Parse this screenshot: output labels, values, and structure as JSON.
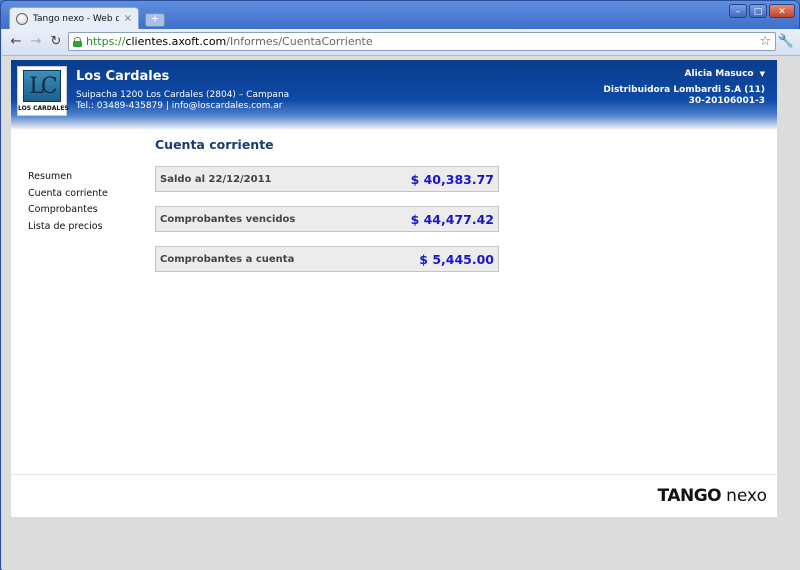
{
  "browser": {
    "tab_title": "Tango nexo - Web de clientes",
    "tab_close": "×",
    "new_tab": "+",
    "url_scheme": "https://",
    "url_host": "clientes.axoft.com",
    "url_path": "/Informes/CuentaCorriente",
    "icons": {
      "back": "←",
      "forward": "→",
      "reload": "↻",
      "star": "☆",
      "wrench": "🔧"
    },
    "window_buttons": {
      "minimize": "–",
      "maximize": "□",
      "close": "✕"
    }
  },
  "header": {
    "logo_mark": "LC",
    "logo_text": "LOS CARDALES",
    "company_name": "Los Cardales",
    "address": "Suipacha 1200 Los Cardales (2804) – Campana",
    "contact": "Tel.: 03489-435879 | info@loscardales.com.ar",
    "user_name": "Alicia Masuco",
    "user_caret": "▼",
    "distributor": "Distribuidora Lombardi S.A (11)",
    "cuit": "30-20106001-3"
  },
  "sidebar": {
    "items": [
      {
        "label": "Resumen"
      },
      {
        "label": "Cuenta corriente"
      },
      {
        "label": "Comprobantes"
      },
      {
        "label": "Lista de precios"
      }
    ]
  },
  "main": {
    "title": "Cuenta corriente",
    "rows": [
      {
        "label": "Saldo al 22/12/2011",
        "value": "$ 40,383.77"
      },
      {
        "label": "Comprobantes vencidos",
        "value": "$ 44,477.42"
      },
      {
        "label": "Comprobantes a cuenta",
        "value": "$ 5,445.00"
      }
    ]
  },
  "footer": {
    "brand_primary": "TANGO",
    "brand_secondary": "nexo"
  },
  "colors": {
    "header_blue": "#0e4aa8",
    "title_blue": "#1b3a6e",
    "value_blue": "#1a16cc"
  }
}
